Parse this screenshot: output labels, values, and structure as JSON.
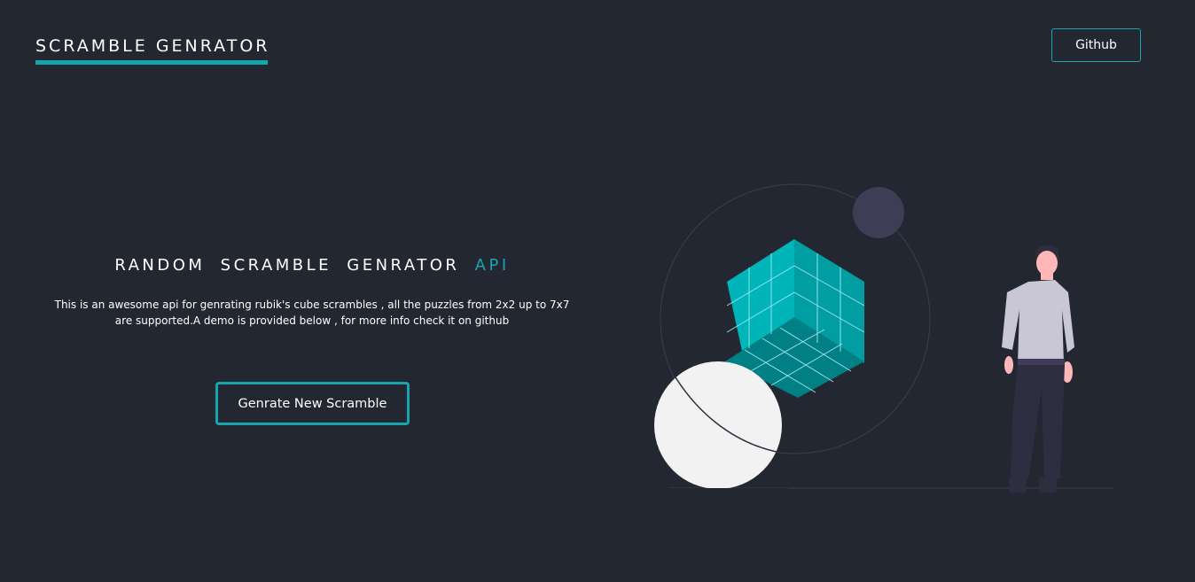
{
  "header": {
    "brand": "SCRAMBLE GENRATOR",
    "github_label": "Github"
  },
  "hero": {
    "title_main": "RANDOM SCRAMBLE GENRATOR",
    "title_accent": "API",
    "description": "This is an awesome api for genrating rubik's cube scrambles , all the puzzles from 2x2 up to 7x7 are supported.A demo is provided below , for more info check it on github",
    "cta_label": "Genrate New Scramble"
  },
  "colors": {
    "background": "#222731",
    "accent": "#16a5ad",
    "cube": "#00b0b5",
    "planet": "#3f3d56",
    "sphere": "#f2f2f2",
    "shirt": "#c9c7d6",
    "pants": "#2f2e41"
  },
  "illustration": {
    "icon": "person-with-rubiks-cube-illustration"
  }
}
